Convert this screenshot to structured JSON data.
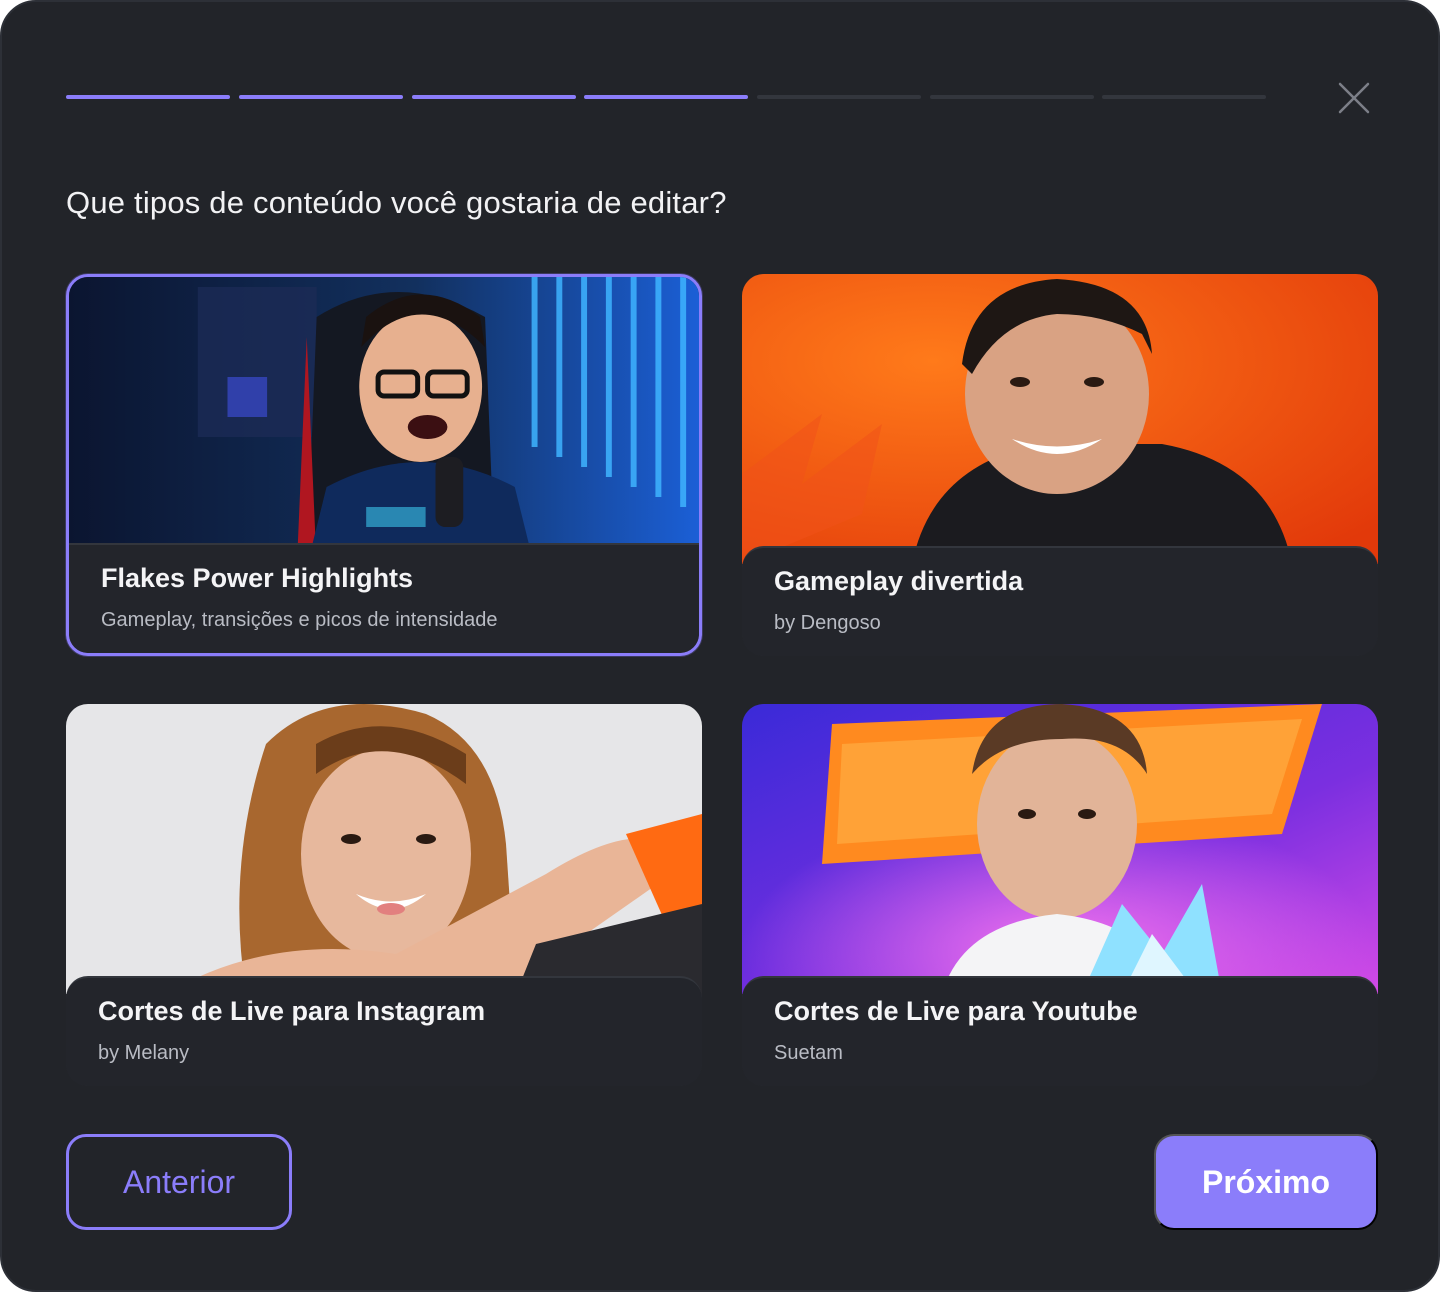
{
  "onboarding": {
    "progress": {
      "total_steps": 7,
      "completed_steps": 4
    },
    "question": "Que tipos de conteúdo você gostaria de editar?",
    "cards": [
      {
        "title": "Flakes Power Highlights",
        "subtitle": "Gameplay, transições e picos de intensidade",
        "selected": true
      },
      {
        "title": "Gameplay divertida",
        "subtitle": "by Dengoso",
        "selected": false
      },
      {
        "title": "Cortes de Live para Instagram",
        "subtitle": "by Melany",
        "selected": false
      },
      {
        "title": "Cortes de Live para Youtube",
        "subtitle": "Suetam",
        "selected": false
      }
    ],
    "buttons": {
      "previous": "Anterior",
      "next": "Próximo"
    }
  },
  "icons": {
    "close": "close-icon"
  },
  "colors": {
    "background": "#222429",
    "accent": "#8b7dfa",
    "progress_inactive": "#33363d",
    "card_info_bg": "#23252b"
  }
}
